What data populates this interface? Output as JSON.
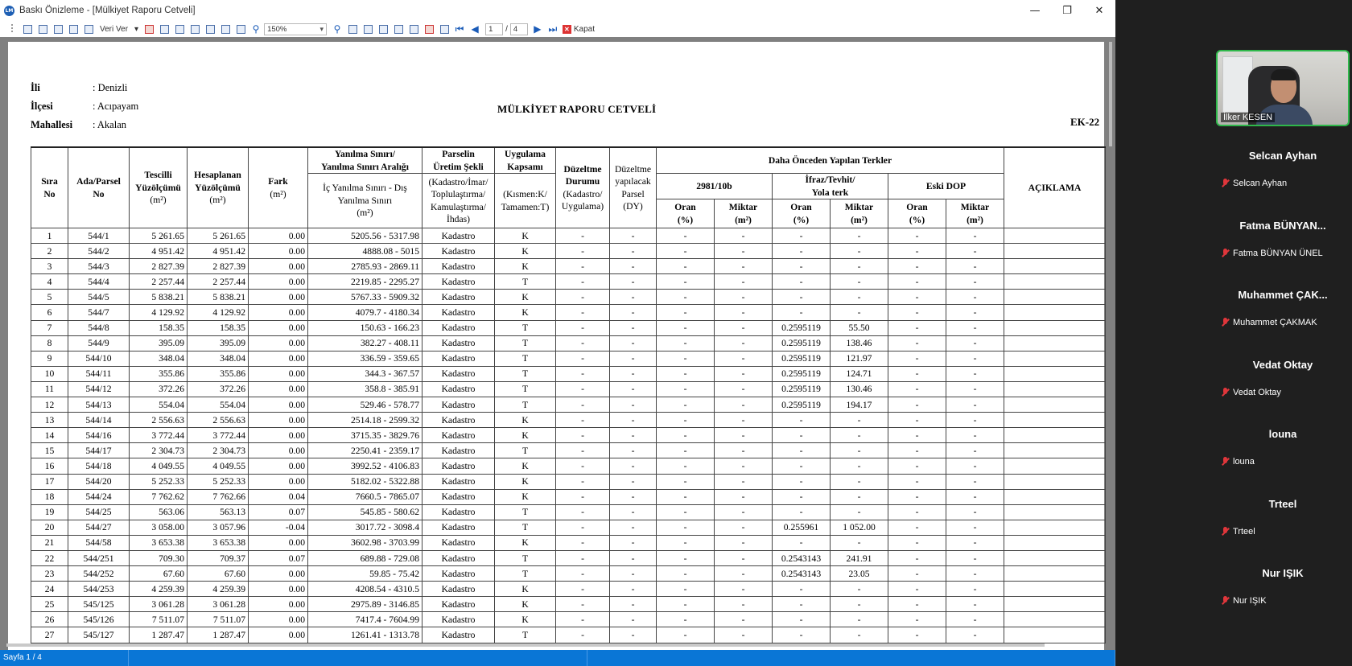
{
  "window": {
    "title": "Baskı Önizleme - [Mülkiyet Raporu Cetveli]",
    "app_icon_text": "LM"
  },
  "toolbar": {
    "veri_label": "Veri Ver",
    "zoom_value": "150%",
    "page_current": "1",
    "page_separator": "/",
    "page_total": "4",
    "close_label": "Kapat"
  },
  "report": {
    "il_label": "İli",
    "il_value": ": Denizli",
    "ilce_label": "İlçesi",
    "ilce_value": ": Acıpayam",
    "mahalle_label": "Mahallesi",
    "mahalle_value": ": Akalan",
    "title": "MÜLKİYET RAPORU CETVELİ",
    "ek": "EK-22",
    "headers": {
      "sira": "Sıra\nNo",
      "ada": "Ada/Parsel\nNo",
      "tescilli": "Tescilli\nYüzölçümü",
      "tescilli_unit": "(m²)",
      "hesaplanan": "Hesaplanan\nYüzölçümü",
      "hesaplanan_unit": "(m²)",
      "fark": "Fark",
      "fark_unit": "(m²)",
      "yanilma_top": "Yanılma Sınırı/\nYanılma Sınırı Aralığı",
      "yanilma_bottom": "İç Yanılma Sınırı - Dış\nYanılma Sınırı",
      "yanilma_unit": "(m²)",
      "parsel_top": "Parselin\nÜretim Şekli",
      "parsel_bottom": "(Kadastro/İmar/\nToplulaştırma/\nKamulaştırma/\nİhdas)",
      "uygulama_top": "Uygulama\nKapsamı",
      "uygulama_bottom": "(Kısmen:K/\nTamamen:T)",
      "duzeltme_durumu": "Düzeltme\nDurumu",
      "duzeltme_durumu_sub": "(Kadastro/\nUygulama)",
      "duzeltme_parsel": "Düzeltme\nyapılacak\nParsel\n(DY)",
      "daha_once": "Daha Önceden Yapılan Terkler",
      "g2981": "2981/10b",
      "ifraz": "İfraz/Tevhit/\nYola terk",
      "eski_dop": "Eski DOP",
      "oran": "Oran\n(%)",
      "miktar": "Miktar\n(m²)",
      "aciklama": "AÇIKLAMA"
    },
    "rows": [
      [
        "1",
        "544/1",
        "5 261.65",
        "5 261.65",
        "0.00",
        "5205.56 - 5317.98",
        "Kadastro",
        "K",
        "-",
        "-",
        "-",
        "-",
        "-",
        "-",
        "-",
        "-",
        ""
      ],
      [
        "2",
        "544/2",
        "4 951.42",
        "4 951.42",
        "0.00",
        "4888.08 - 5015",
        "Kadastro",
        "K",
        "-",
        "-",
        "-",
        "-",
        "-",
        "-",
        "-",
        "-",
        ""
      ],
      [
        "3",
        "544/3",
        "2 827.39",
        "2 827.39",
        "0.00",
        "2785.93 - 2869.11",
        "Kadastro",
        "K",
        "-",
        "-",
        "-",
        "-",
        "-",
        "-",
        "-",
        "-",
        ""
      ],
      [
        "4",
        "544/4",
        "2 257.44",
        "2 257.44",
        "0.00",
        "2219.85 - 2295.27",
        "Kadastro",
        "T",
        "-",
        "-",
        "-",
        "-",
        "-",
        "-",
        "-",
        "-",
        ""
      ],
      [
        "5",
        "544/5",
        "5 838.21",
        "5 838.21",
        "0.00",
        "5767.33 - 5909.32",
        "Kadastro",
        "K",
        "-",
        "-",
        "-",
        "-",
        "-",
        "-",
        "-",
        "-",
        ""
      ],
      [
        "6",
        "544/7",
        "4 129.92",
        "4 129.92",
        "0.00",
        "4079.7 - 4180.34",
        "Kadastro",
        "K",
        "-",
        "-",
        "-",
        "-",
        "-",
        "-",
        "-",
        "-",
        ""
      ],
      [
        "7",
        "544/8",
        "158.35",
        "158.35",
        "0.00",
        "150.63 - 166.23",
        "Kadastro",
        "T",
        "-",
        "-",
        "-",
        "-",
        "0.2595119",
        "55.50",
        "-",
        "-",
        ""
      ],
      [
        "8",
        "544/9",
        "395.09",
        "395.09",
        "0.00",
        "382.27 - 408.11",
        "Kadastro",
        "T",
        "-",
        "-",
        "-",
        "-",
        "0.2595119",
        "138.46",
        "-",
        "-",
        ""
      ],
      [
        "9",
        "544/10",
        "348.04",
        "348.04",
        "0.00",
        "336.59 - 359.65",
        "Kadastro",
        "T",
        "-",
        "-",
        "-",
        "-",
        "0.2595119",
        "121.97",
        "-",
        "-",
        ""
      ],
      [
        "10",
        "544/11",
        "355.86",
        "355.86",
        "0.00",
        "344.3 - 367.57",
        "Kadastro",
        "T",
        "-",
        "-",
        "-",
        "-",
        "0.2595119",
        "124.71",
        "-",
        "-",
        ""
      ],
      [
        "11",
        "544/12",
        "372.26",
        "372.26",
        "0.00",
        "358.8 - 385.91",
        "Kadastro",
        "T",
        "-",
        "-",
        "-",
        "-",
        "0.2595119",
        "130.46",
        "-",
        "-",
        ""
      ],
      [
        "12",
        "544/13",
        "554.04",
        "554.04",
        "0.00",
        "529.46 - 578.77",
        "Kadastro",
        "T",
        "-",
        "-",
        "-",
        "-",
        "0.2595119",
        "194.17",
        "-",
        "-",
        ""
      ],
      [
        "13",
        "544/14",
        "2 556.63",
        "2 556.63",
        "0.00",
        "2514.18 - 2599.32",
        "Kadastro",
        "K",
        "-",
        "-",
        "-",
        "-",
        "-",
        "-",
        "-",
        "-",
        ""
      ],
      [
        "14",
        "544/16",
        "3 772.44",
        "3 772.44",
        "0.00",
        "3715.35 - 3829.76",
        "Kadastro",
        "K",
        "-",
        "-",
        "-",
        "-",
        "-",
        "-",
        "-",
        "-",
        ""
      ],
      [
        "15",
        "544/17",
        "2 304.73",
        "2 304.73",
        "0.00",
        "2250.41 - 2359.17",
        "Kadastro",
        "T",
        "-",
        "-",
        "-",
        "-",
        "-",
        "-",
        "-",
        "-",
        ""
      ],
      [
        "16",
        "544/18",
        "4 049.55",
        "4 049.55",
        "0.00",
        "3992.52 - 4106.83",
        "Kadastro",
        "K",
        "-",
        "-",
        "-",
        "-",
        "-",
        "-",
        "-",
        "-",
        ""
      ],
      [
        "17",
        "544/20",
        "5 252.33",
        "5 252.33",
        "0.00",
        "5182.02 - 5322.88",
        "Kadastro",
        "K",
        "-",
        "-",
        "-",
        "-",
        "-",
        "-",
        "-",
        "-",
        ""
      ],
      [
        "18",
        "544/24",
        "7 762.62",
        "7 762.66",
        "0.04",
        "7660.5 - 7865.07",
        "Kadastro",
        "K",
        "-",
        "-",
        "-",
        "-",
        "-",
        "-",
        "-",
        "-",
        ""
      ],
      [
        "19",
        "544/25",
        "563.06",
        "563.13",
        "0.07",
        "545.85 - 580.62",
        "Kadastro",
        "T",
        "-",
        "-",
        "-",
        "-",
        "-",
        "-",
        "-",
        "-",
        ""
      ],
      [
        "20",
        "544/27",
        "3 058.00",
        "3 057.96",
        "-0.04",
        "3017.72 - 3098.4",
        "Kadastro",
        "T",
        "-",
        "-",
        "-",
        "-",
        "0.255961",
        "1 052.00",
        "-",
        "-",
        ""
      ],
      [
        "21",
        "544/58",
        "3 653.38",
        "3 653.38",
        "0.00",
        "3602.98 - 3703.99",
        "Kadastro",
        "K",
        "-",
        "-",
        "-",
        "-",
        "-",
        "-",
        "-",
        "-",
        ""
      ],
      [
        "22",
        "544/251",
        "709.30",
        "709.37",
        "0.07",
        "689.88 - 729.08",
        "Kadastro",
        "T",
        "-",
        "-",
        "-",
        "-",
        "0.2543143",
        "241.91",
        "-",
        "-",
        ""
      ],
      [
        "23",
        "544/252",
        "67.60",
        "67.60",
        "0.00",
        "59.85 - 75.42",
        "Kadastro",
        "T",
        "-",
        "-",
        "-",
        "-",
        "0.2543143",
        "23.05",
        "-",
        "-",
        ""
      ],
      [
        "24",
        "544/253",
        "4 259.39",
        "4 259.39",
        "0.00",
        "4208.54 - 4310.5",
        "Kadastro",
        "K",
        "-",
        "-",
        "-",
        "-",
        "-",
        "-",
        "-",
        "-",
        ""
      ],
      [
        "25",
        "545/125",
        "3 061.28",
        "3 061.28",
        "0.00",
        "2975.89 - 3146.85",
        "Kadastro",
        "K",
        "-",
        "-",
        "-",
        "-",
        "-",
        "-",
        "-",
        "-",
        ""
      ],
      [
        "26",
        "545/126",
        "7 511.07",
        "7 511.07",
        "0.00",
        "7417.4 - 7604.99",
        "Kadastro",
        "K",
        "-",
        "-",
        "-",
        "-",
        "-",
        "-",
        "-",
        "-",
        ""
      ],
      [
        "27",
        "545/127",
        "1 287.47",
        "1 287.47",
        "0.00",
        "1261.41 - 1313.78",
        "Kadastro",
        "T",
        "-",
        "-",
        "-",
        "-",
        "-",
        "-",
        "-",
        "-",
        ""
      ]
    ]
  },
  "statusbar": {
    "page_text": "Sayfa 1 / 4"
  },
  "meeting": {
    "self_name": "İlker KESEN",
    "participants": [
      {
        "title": "Selcan Ayhan",
        "name": "Selcan Ayhan"
      },
      {
        "title": "Fatma BÜNYAN...",
        "name": "Fatma BÜNYAN ÜNEL"
      },
      {
        "title": "Muhammet ÇAK...",
        "name": "Muhammet ÇAKMAK"
      },
      {
        "title": "Vedat Oktay",
        "name": "Vedat Oktay"
      },
      {
        "title": "louna",
        "name": "louna"
      },
      {
        "title": "Trteel",
        "name": "Trteel"
      },
      {
        "title": "Nur IŞIK",
        "name": "Nur IŞIK"
      }
    ]
  },
  "colors": {
    "statusbar": "#0a76d6",
    "self_video_border": "#2fb84b",
    "muted_mic": "#e0363b",
    "panel_bg": "#1f1f1f"
  }
}
